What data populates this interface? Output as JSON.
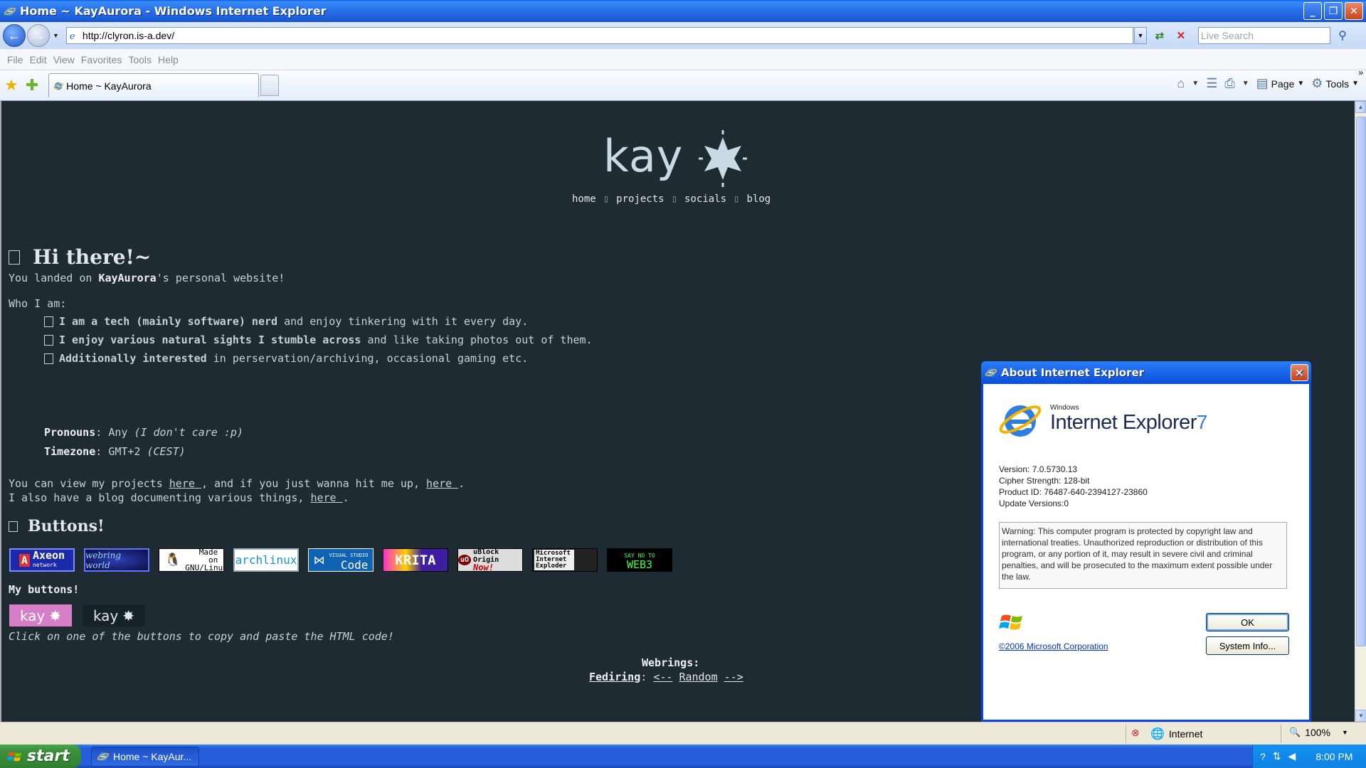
{
  "window": {
    "title": "Home ~ KayAurora - Windows Internet Explorer",
    "minimize": "_",
    "maximize": "❐",
    "close": "✕"
  },
  "address_bar": {
    "url": "http://clyron.is-a.dev/",
    "search_placeholder": "Live Search"
  },
  "menu": [
    "File",
    "Edit",
    "View",
    "Favorites",
    "Tools",
    "Help"
  ],
  "tabs": [
    {
      "label": "Home ~ KayAurora"
    }
  ],
  "command_bar": {
    "page": "Page",
    "tools": "Tools"
  },
  "site": {
    "logo_text": "kay",
    "nav": [
      "home",
      "projects",
      "socials",
      "blog"
    ],
    "heading": "Hi there!~",
    "intro": {
      "pre": "You landed on ",
      "name": "KayAurora",
      "post": "'s personal website!"
    },
    "who_label": "Who I am:",
    "bullets": [
      {
        "bold": "I am a tech (mainly software) nerd",
        "rest": " and enjoy tinkering with it every day."
      },
      {
        "bold": "I enjoy various natural sights I stumble across",
        "rest": " and like taking photos out of them."
      },
      {
        "bold": "Additionally interested",
        "rest": " in perservation/archiving, occasional gaming etc."
      }
    ],
    "pronouns": {
      "label": "Pronouns",
      "value": "Any",
      "note": "(I don't care :p)"
    },
    "timezone": {
      "label": "Timezone",
      "value": "GMT+2",
      "note": "(CEST)"
    },
    "projects_line": {
      "pre": "You can view my projects ",
      "link1": "here ",
      "mid": ", and if you just wanna hit me up, ",
      "link2": "here ",
      "post": "."
    },
    "blog_line": {
      "pre": "I also have a blog documenting various things, ",
      "link": "here ",
      "post": "."
    },
    "buttons_heading": "Buttons!",
    "badges": {
      "axeon": "Axeon",
      "axeon_sub": "network",
      "webring": "webring world",
      "gnu": "Made on GNU/Linux",
      "arch": "archlinux",
      "vscode_top": "VISUAL STUDIO",
      "vscode": "Code",
      "krita": "KRITA",
      "ublock": "uBlock Origin",
      "ublock_sub": "Now!",
      "msie": "Microsoft Internet Exploder",
      "web3_top": "SAY NO TO",
      "web3": "WEB3"
    },
    "my_buttons_label": "My buttons!",
    "my_buttons": [
      "kay",
      "kay"
    ],
    "copy_hint": "Click on one of the buttons to copy and paste the HTML code!",
    "webrings_label": "Webrings:",
    "fediring": {
      "label": "Fediring",
      "prev": "<--",
      "random": "Random",
      "next": "-->"
    }
  },
  "about_dialog": {
    "title": "About Internet Explorer",
    "logo_windows": "Windows",
    "logo_name": "Internet Explorer",
    "logo_version": "7",
    "version": "Version: 7.0.5730.13",
    "cipher": "Cipher Strength: 128-bit",
    "product_id": "Product ID: 76487-640-2394127-23860",
    "update_versions": "Update Versions:0",
    "warning": "Warning: This computer program is protected by copyright law and international treaties. Unauthorized reproduction or distribution of this program, or any portion of it, may result in severe civil and criminal penalties, and will be prosecuted to the maximum extent possible under the law.",
    "copyright": "©2006 Microsoft Corporation",
    "ok": "OK",
    "system_info": "System Info..."
  },
  "status_bar": {
    "zone": "Internet",
    "zoom": "100%"
  },
  "taskbar": {
    "start": "start",
    "task": "Home ~ KayAur...",
    "clock": "8:00 PM"
  }
}
